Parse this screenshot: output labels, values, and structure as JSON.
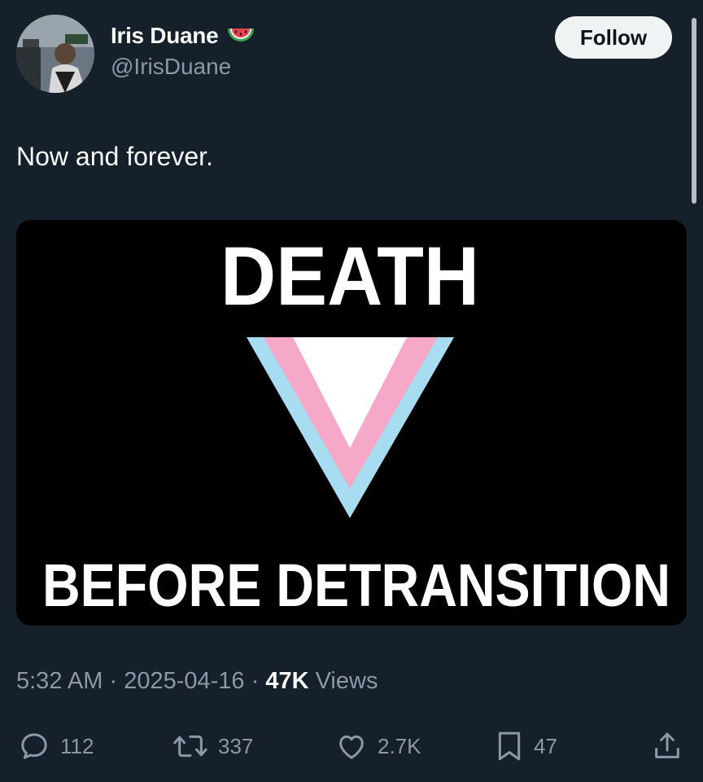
{
  "author": {
    "display_name": "Iris Duane",
    "handle": "@IrisDuane",
    "badge_emoji": "watermelon-icon"
  },
  "follow_label": "Follow",
  "tweet": {
    "text": "Now and forever.",
    "image": {
      "top_text": "DEATH",
      "bottom_text": "BEFORE DETRANSITION",
      "colors": {
        "background": "#000000",
        "text": "#ffffff",
        "blue": "#a8dcf0",
        "pink": "#f5a8c8",
        "white": "#ffffff"
      }
    }
  },
  "meta": {
    "time": "5:32 AM",
    "separator": "·",
    "date": "2025-04-16",
    "views_count": "47K",
    "views_label": "Views"
  },
  "actions": {
    "replies": "112",
    "reposts": "337",
    "likes": "2.7K",
    "bookmarks": "47"
  },
  "colors": {
    "background": "#15202b",
    "text_primary": "#f7f9f9",
    "text_secondary": "#8b98a5",
    "follow_bg": "#eff3f4"
  }
}
